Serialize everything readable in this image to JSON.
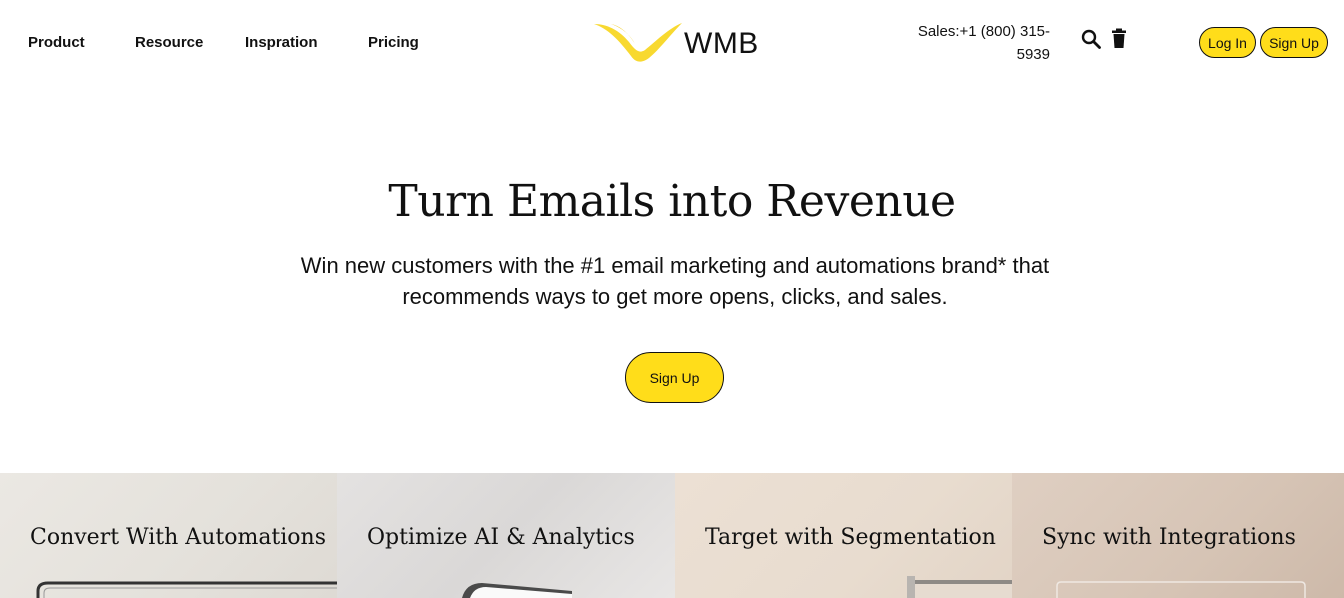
{
  "nav": {
    "items": [
      {
        "label": "Product"
      },
      {
        "label": "Resource"
      },
      {
        "label": "Inspration"
      },
      {
        "label": "Pricing"
      }
    ]
  },
  "logo": {
    "text": "WMB",
    "color": "#f8d930"
  },
  "header": {
    "sales_line1": "Sales:+1 (800) 315-",
    "sales_line2": "5939",
    "search_icon": "search-icon",
    "trash_icon": "trash-icon",
    "login_label": "Log In",
    "signup_label": "Sign Up"
  },
  "hero": {
    "title": "Turn Emails into Revenue",
    "subtitle_line1": "Win new customers with the #1 email marketing and automations brand* that",
    "subtitle_line2": "recommends ways to get more opens, clicks, and sales.",
    "cta_label": "Sign Up"
  },
  "cards": [
    {
      "title": "Convert With Automations"
    },
    {
      "title": "Optimize AI & Analytics"
    },
    {
      "title": "Target with Segmentation"
    },
    {
      "title": "Sync with Integrations"
    }
  ],
  "colors": {
    "accent": "#ffdd1a",
    "text": "#111111"
  }
}
